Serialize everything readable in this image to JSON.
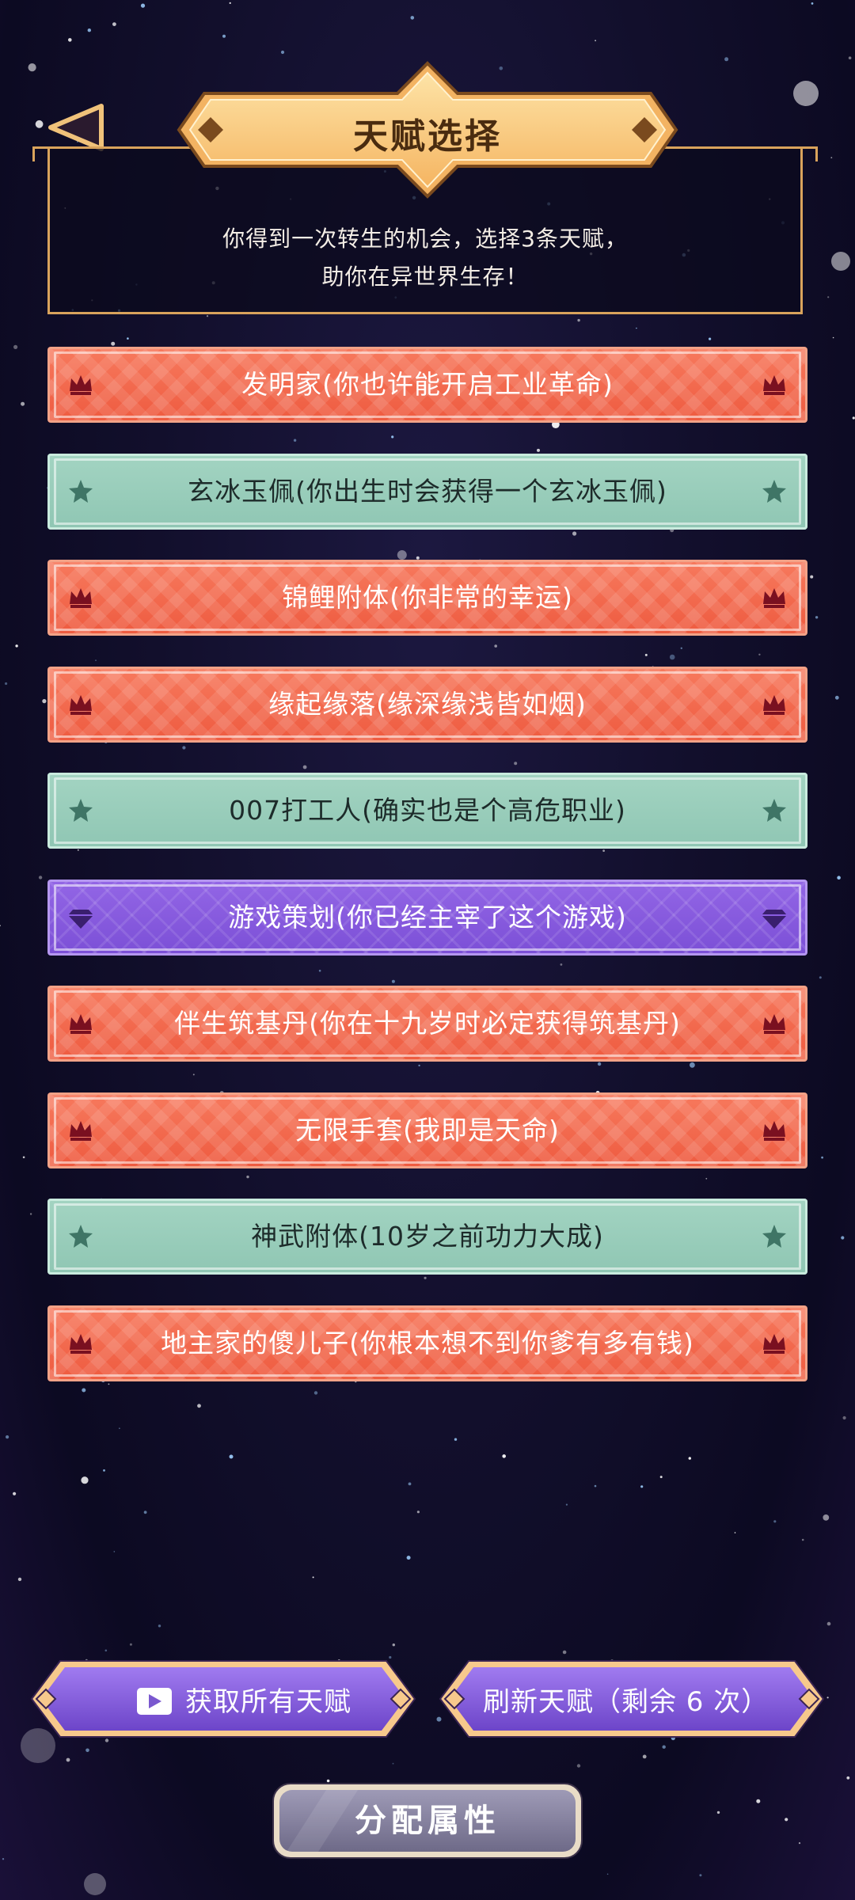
{
  "header": {
    "title": "天赋选择",
    "description_line1": "你得到一次转生的机会，选择3条天赋，",
    "description_line2": "助你在异世界生存！"
  },
  "talents": [
    {
      "label": "发明家(你也许能开启工业革命)",
      "rarity": "gold",
      "icon": "crown-icon"
    },
    {
      "label": "玄冰玉佩(你出生时会获得一个玄冰玉佩)",
      "rarity": "blue",
      "icon": "star-icon"
    },
    {
      "label": "锦鲤附体(你非常的幸运)",
      "rarity": "gold",
      "icon": "crown-icon"
    },
    {
      "label": "缘起缘落(缘深缘浅皆如烟)",
      "rarity": "gold",
      "icon": "crown-icon"
    },
    {
      "label": "007打工人(确实也是个高危职业)",
      "rarity": "blue",
      "icon": "star-icon"
    },
    {
      "label": "游戏策划(你已经主宰了这个游戏)",
      "rarity": "purple",
      "icon": "diamond-icon"
    },
    {
      "label": "伴生筑基丹(你在十九岁时必定获得筑基丹)",
      "rarity": "gold",
      "icon": "crown-icon"
    },
    {
      "label": "无限手套(我即是天命)",
      "rarity": "gold",
      "icon": "crown-icon"
    },
    {
      "label": "神武附体(10岁之前功力大成)",
      "rarity": "blue",
      "icon": "star-icon"
    },
    {
      "label": "地主家的傻儿子(你根本想不到你爹有多有钱)",
      "rarity": "gold",
      "icon": "crown-icon"
    }
  ],
  "buttons": {
    "get_all": "获取所有天赋",
    "refresh": "刷新天赋（剩余 6 次）",
    "allocate": "分配属性"
  },
  "colors": {
    "gold": "#f26a4f",
    "blue": "#9ccfbd",
    "purple": "#8a5de0",
    "frame": "#d9a35c"
  }
}
